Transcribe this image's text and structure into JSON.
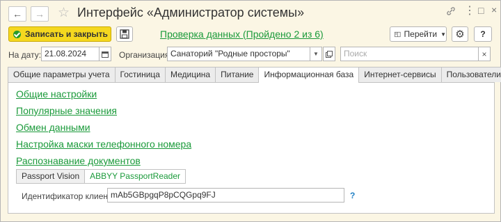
{
  "window": {
    "title": "Интерфейс «Администратор системы»",
    "icons": [
      "back-arrow-icon",
      "forward-arrow-icon",
      "star-icon",
      "link-icon",
      "more-icon",
      "maximize-icon",
      "close-icon"
    ]
  },
  "toolbar": {
    "save_close_label": "Записать и закрыть",
    "check_link": "Проверка данных (Пройдено 2 из 6)",
    "goto_label": "Перейти",
    "help_label": "?"
  },
  "filters": {
    "date_label": "На дату:",
    "date_value": "21.08.2024",
    "org_label": "Организация:",
    "org_value": "Санаторий \"Родные просторы\"",
    "search_placeholder": "Поиск"
  },
  "tabs": [
    {
      "label": "Общие параметры учета"
    },
    {
      "label": "Гостиница"
    },
    {
      "label": "Медицина"
    },
    {
      "label": "Питание"
    },
    {
      "label": "Информационная база",
      "active": true
    },
    {
      "label": "Интернет-сервисы"
    },
    {
      "label": "Пользователи"
    }
  ],
  "panel": {
    "links": [
      "Общие настройки",
      "Популярные значения",
      "Обмен данными",
      "Настройка маски телефонного номера",
      "Распознавание документов"
    ],
    "subtabs": [
      "Passport Vision",
      "ABBYY PassportReader"
    ],
    "client_id_label": "Идентификатор клиента:",
    "client_id_value": "mAb5GBpgqP8pCQGpq9FJ",
    "help_mark": "?"
  },
  "colors": {
    "accent_yellow": "#f5d81f",
    "link_green": "#1a9a3a",
    "window_bg": "#fbf6e4"
  }
}
